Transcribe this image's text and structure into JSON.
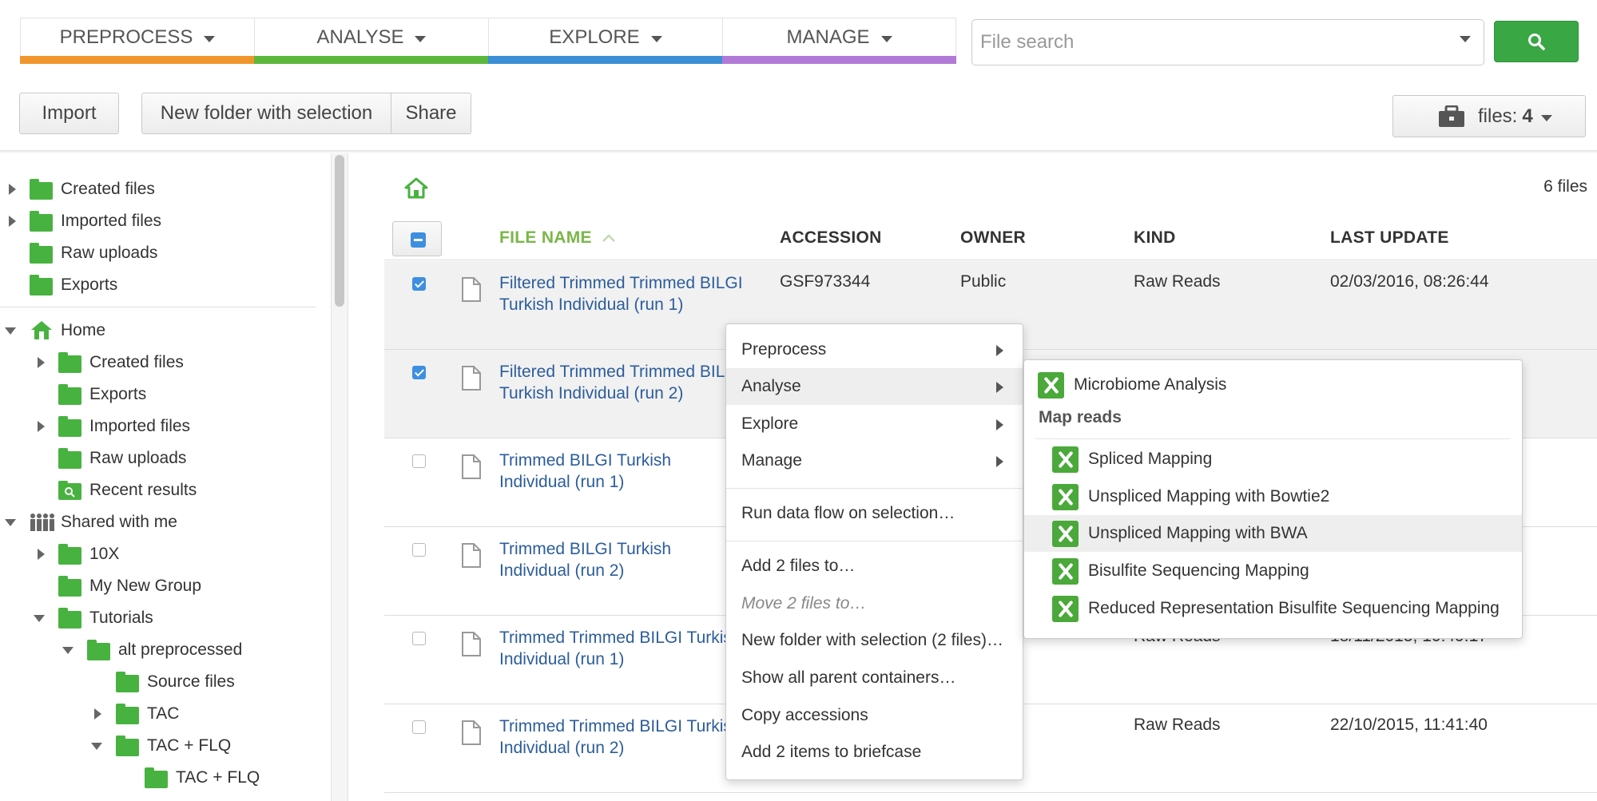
{
  "nav": {
    "tabs": [
      {
        "label": "PREPROCESS",
        "color": "#f0962d"
      },
      {
        "label": "ANALYSE",
        "color": "#5cb83c"
      },
      {
        "label": "EXPLORE",
        "color": "#3b8fd6"
      },
      {
        "label": "MANAGE",
        "color": "#b07ad6"
      }
    ]
  },
  "search": {
    "placeholder": "File search"
  },
  "toolbar": {
    "import_label": "Import",
    "new_folder_label": "New folder with selection",
    "share_label": "Share",
    "files_label": "files:",
    "files_count": "4"
  },
  "sidebar": {
    "top_items": [
      "Created files",
      "Imported files",
      "Raw uploads",
      "Exports"
    ],
    "home": "Home",
    "home_items": [
      "Created files",
      "Exports",
      "Imported files",
      "Raw uploads",
      "Recent results"
    ],
    "shared": "Shared with me",
    "shared_items": [
      "10X",
      "My New Group",
      "Tutorials"
    ],
    "tutorials_items": [
      "alt preprocessed"
    ],
    "alt_items": [
      "Source files",
      "TAC",
      "TAC + FLQ"
    ],
    "flq_items": [
      "TAC + FLQ"
    ]
  },
  "table": {
    "count": "6 files",
    "headers": {
      "name": "FILE NAME",
      "accession": "ACCESSION",
      "owner": "OWNER",
      "kind": "KIND",
      "updated": "LAST UPDATE"
    },
    "rows": [
      {
        "name": "Filtered Trimmed Trimmed BILGI Turkish Individual (run 1)",
        "accession": "GSF973344",
        "owner": "Public",
        "kind": "Raw Reads",
        "updated": "02/03/2016, 08:26:44",
        "checked": true
      },
      {
        "name": "Filtered Trimmed Trimmed BILGI Turkish Individual (run 2)",
        "accession": "",
        "owner": "",
        "kind": "",
        "updated": "",
        "checked": true
      },
      {
        "name": "Trimmed BILGI Turkish Individual (run 1)",
        "accession": "",
        "owner": "",
        "kind": "",
        "updated": "",
        "checked": false
      },
      {
        "name": "Trimmed BILGI Turkish Individual (run 2)",
        "accession": "",
        "owner": "",
        "kind": "",
        "updated": "",
        "checked": false
      },
      {
        "name": "Trimmed Trimmed BILGI Turkish Individual (run 1)",
        "accession": "",
        "owner": "",
        "kind": "Raw Reads",
        "updated": "18/11/2015, 10:49:17",
        "checked": false
      },
      {
        "name": "Trimmed Trimmed BILGI Turkish Individual (run 2)",
        "accession": "",
        "owner": "",
        "kind": "Raw Reads",
        "updated": "22/10/2015, 11:41:40",
        "checked": false
      }
    ]
  },
  "context_menu": {
    "items": [
      "Preprocess",
      "Analyse",
      "Explore",
      "Manage"
    ],
    "run": "Run data flow on selection…",
    "add": "Add 2 files to…",
    "move": "Move 2 files to…",
    "new_folder": "New folder with selection (2 files)…",
    "parents": "Show all parent containers…",
    "copy": "Copy accessions",
    "briefcase": "Add 2 items to briefcase"
  },
  "submenu": {
    "microbiome": "Microbiome Analysis",
    "heading": "Map reads",
    "items": [
      "Spliced Mapping",
      "Unspliced Mapping with Bowtie2",
      "Unspliced Mapping with BWA",
      "Bisulfite Sequencing Mapping",
      "Reduced Representation Bisulfite Sequencing Mapping"
    ]
  }
}
